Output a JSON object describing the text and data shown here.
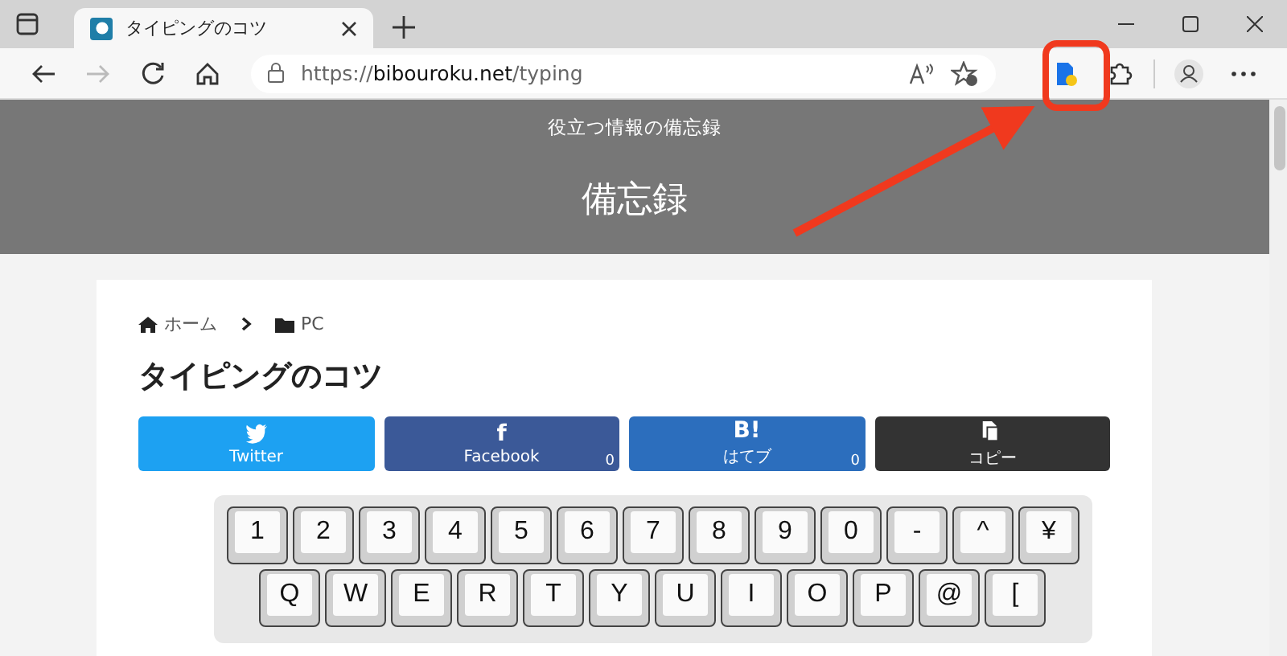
{
  "window": {
    "tabs": [
      {
        "title": "タイピングのコツ",
        "selected": true
      }
    ],
    "address": {
      "scheme": "https://",
      "host": "bibouroku.net",
      "path": "/typing"
    },
    "forward_disabled": true
  },
  "site": {
    "tagline": "役立つ情報の備忘録",
    "title": "備忘録"
  },
  "breadcrumb": [
    {
      "label": "ホーム",
      "kind": "home"
    },
    {
      "label": "PC",
      "kind": "folder"
    }
  ],
  "article": {
    "title": "タイピングのコツ"
  },
  "share_buttons": [
    {
      "label": "Twitter",
      "kind": "twitter",
      "color": "#1da1f2"
    },
    {
      "label": "Facebook",
      "kind": "facebook",
      "glyph": "f",
      "count": "0",
      "color": "#3b5998"
    },
    {
      "label": "はてブ",
      "kind": "hatena",
      "glyph": "B!",
      "count": "0",
      "color": "#2c6ebd"
    },
    {
      "label": "コピー",
      "kind": "copy",
      "color": "#333333"
    }
  ],
  "keyboard": {
    "rows": [
      [
        "1",
        "2",
        "3",
        "4",
        "5",
        "6",
        "7",
        "8",
        "9",
        "0",
        "-",
        "^",
        "¥"
      ],
      [
        "Q",
        "W",
        "E",
        "R",
        "T",
        "Y",
        "U",
        "I",
        "O",
        "P",
        "@",
        "["
      ]
    ]
  }
}
